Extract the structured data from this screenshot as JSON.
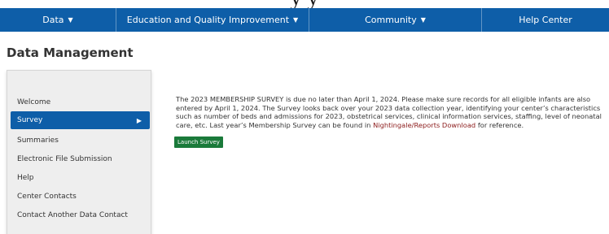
{
  "header_fragment": "y y",
  "nav": {
    "items": [
      {
        "label": "Data",
        "caret": "▼"
      },
      {
        "label": "Education and Quality Improvement",
        "caret": "▼"
      },
      {
        "label": "Community",
        "caret": "▼"
      },
      {
        "label": "Help Center"
      }
    ]
  },
  "page_title": "Data Management",
  "sidebar": {
    "items": [
      {
        "label": "Welcome"
      },
      {
        "label": "Survey",
        "active": true,
        "arrow": "▶"
      },
      {
        "label": "Summaries"
      },
      {
        "label": "Electronic File Submission"
      },
      {
        "label": "Help"
      },
      {
        "label": "Center Contacts"
      },
      {
        "label": "Contact Another Data Contact"
      }
    ]
  },
  "content": {
    "text_before_link": "The 2023 MEMBERSHIP SURVEY is due no later than April 1, 2024. Please make sure records for all eligible infants are also entered by April 1, 2024. The Survey looks back over your 2023 data collection year, identifying your center’s characteristics such as number of beds and admissions for 2023, obstetrical services, clinical information services, staffing, level of neonatal care, etc. Last year’s Membership Survey can be found in ",
    "link_text": "Nightingale/Reports Download",
    "text_after_link": " for reference.",
    "launch_button": "Launch Survey"
  },
  "colors": {
    "nav_bg": "#0e5ea8",
    "active_item": "#0e5ea8",
    "link": "#8b1a1a",
    "button": "#1a7a3a"
  }
}
